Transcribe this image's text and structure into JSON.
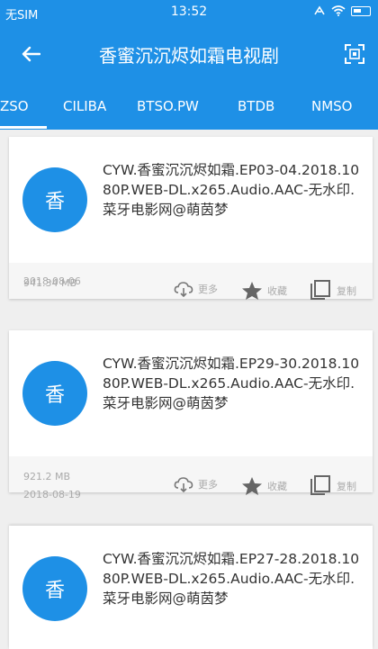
{
  "status_bar": {
    "carrier": "无SIM",
    "time": "13:52"
  },
  "header": {
    "title": "香蜜沉沉烬如霜电视剧"
  },
  "tabs": [
    {
      "label": "ZSO"
    },
    {
      "label": "CILIBA"
    },
    {
      "label": "BTSO.PW"
    },
    {
      "label": "BTDB"
    },
    {
      "label": "NMSO"
    }
  ],
  "results": [
    {
      "avatar": "香",
      "title": "CYW.香蜜沉沉烬如霜.EP03-04.2018.1080P.WEB-DL.x265.Audio.AAC-无水印.菜牙电影网@萌茵梦",
      "size": "941.34 MB",
      "date": "2018-08-06",
      "more_label": "更多",
      "fav_label": "收藏",
      "copy_label": "复制"
    },
    {
      "avatar": "香",
      "title": "CYW.香蜜沉沉烬如霜.EP29-30.2018.1080P.WEB-DL.x265.Audio.AAC-无水印.菜牙电影网@萌茵梦",
      "size": "921.2 MB",
      "date": "2018-08-19",
      "more_label": "更多",
      "fav_label": "收藏",
      "copy_label": "复制"
    },
    {
      "avatar": "香",
      "title": "CYW.香蜜沉沉烬如霜.EP27-28.2018.1080P.WEB-DL.x265.Audio.AAC-无水印.菜牙电影网@萌茵梦"
    }
  ],
  "colors": {
    "primary": "#1e90e6",
    "footer_bg": "#f6f6f6",
    "meta_text": "#aaaaaa"
  }
}
